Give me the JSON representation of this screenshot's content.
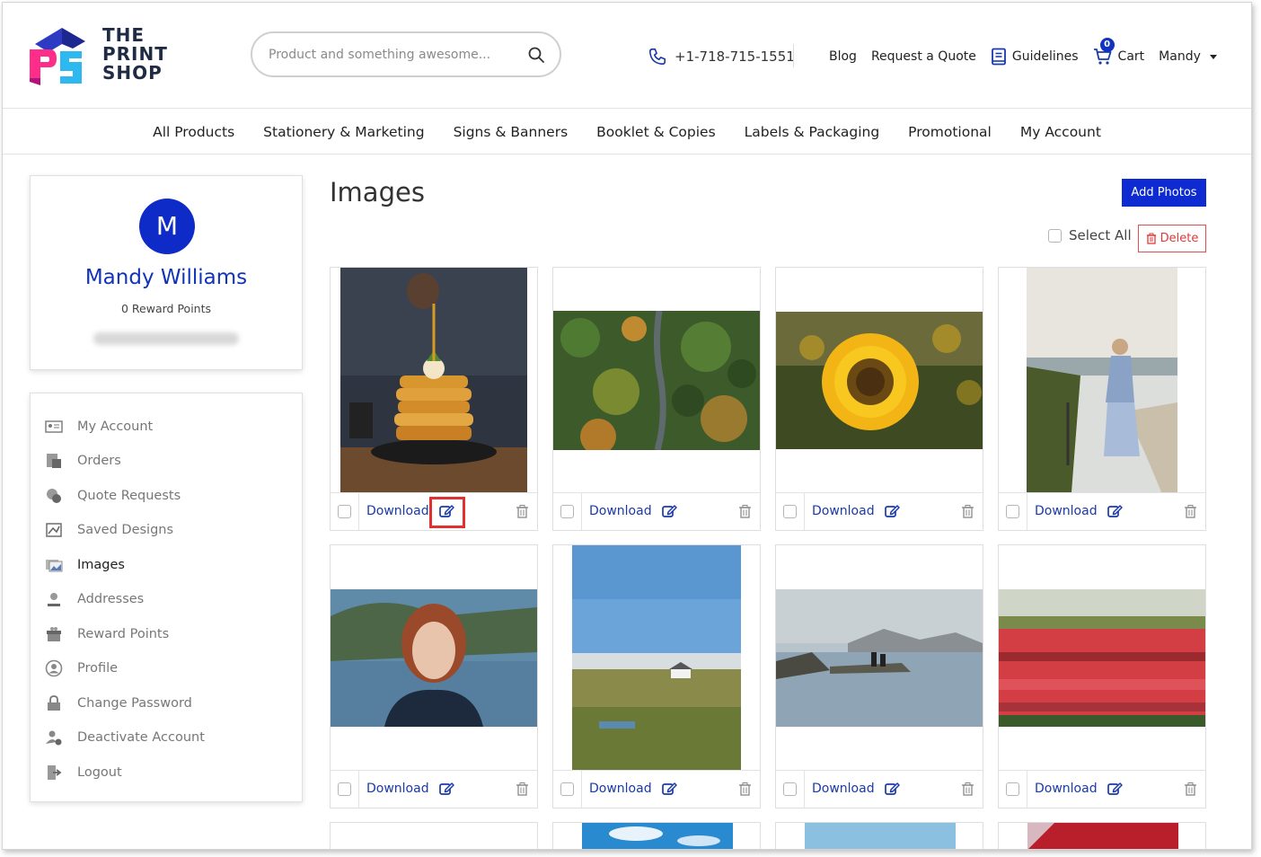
{
  "brand": {
    "line1": "THE",
    "line2": "PRINT",
    "line3": "SHOP"
  },
  "search": {
    "placeholder": "Product and something awesome..."
  },
  "header": {
    "phone": "+1-718-715-1551",
    "blog": "Blog",
    "request_quote": "Request a Quote",
    "guidelines": "Guidelines",
    "cart_count": "0",
    "cart": "Cart",
    "user": "Mandy"
  },
  "nav": [
    "All Products",
    "Stationery & Marketing",
    "Signs & Banners",
    "Booklet & Copies",
    "Labels & Packaging",
    "Promotional",
    "My Account"
  ],
  "profile": {
    "initial": "M",
    "name": "Mandy Williams",
    "points": "0 Reward Points"
  },
  "menu": [
    {
      "label": "My Account",
      "icon": "account-card-icon"
    },
    {
      "label": "Orders",
      "icon": "orders-icon"
    },
    {
      "label": "Quote Requests",
      "icon": "quote-requests-icon"
    },
    {
      "label": "Saved Designs",
      "icon": "saved-designs-icon"
    },
    {
      "label": "Images",
      "icon": "images-icon"
    },
    {
      "label": "Addresses",
      "icon": "addresses-icon"
    },
    {
      "label": "Reward Points",
      "icon": "reward-points-icon"
    },
    {
      "label": "Profile",
      "icon": "profile-icon"
    },
    {
      "label": "Change Password",
      "icon": "change-password-icon"
    },
    {
      "label": "Deactivate Account",
      "icon": "deactivate-account-icon"
    },
    {
      "label": "Logout",
      "icon": "logout-icon"
    }
  ],
  "page": {
    "title": "Images",
    "add_photos": "Add Photos",
    "select_all": "Select All",
    "delete": "Delete"
  },
  "card": {
    "download": "Download"
  },
  "images": [
    "pancakes",
    "forest-road",
    "sunflower",
    "woman-coast",
    "woman-portrait",
    "field-house",
    "lake-reflection",
    "tulip-field"
  ],
  "colors": {
    "accent": "#0d2bd0",
    "link": "#1a3aa8",
    "danger": "#e03a3a",
    "highlight": "#e03030"
  }
}
